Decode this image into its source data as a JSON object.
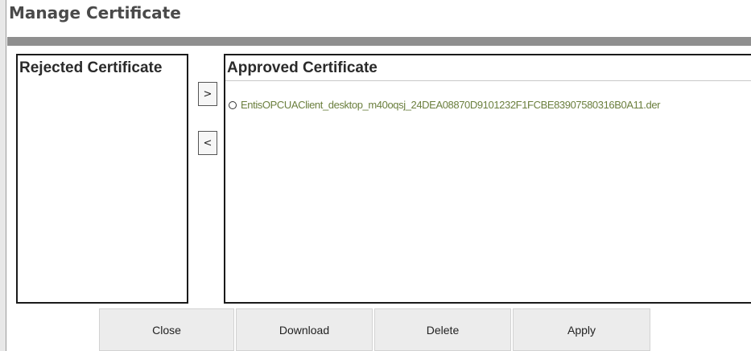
{
  "dialog": {
    "title": "Manage Certificate"
  },
  "rejected_panel": {
    "header": "Rejected Certificate",
    "items": []
  },
  "approved_panel": {
    "header": "Approved Certificate",
    "items": [
      {
        "label": "EntisOPCUAClient_desktop_m40oqsj_24DEA08870D9101232F1FCBE83907580316B0A11.der",
        "selected": false
      }
    ]
  },
  "transfer": {
    "move_right": ">",
    "move_left": "<"
  },
  "actions": {
    "close": "Close",
    "download": "Download",
    "delete": "Delete",
    "apply": "Apply"
  },
  "colors": {
    "title_bar": "#8f8f8f",
    "item_text": "#6b7f3e",
    "button_bg": "#ececec"
  }
}
